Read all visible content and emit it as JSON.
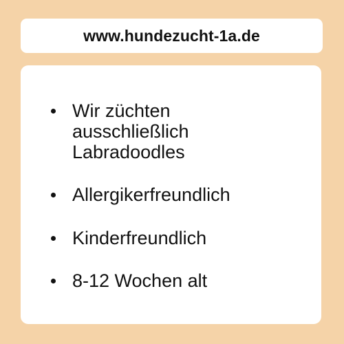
{
  "header": {
    "url": "www.hundezucht-1a.de"
  },
  "features": [
    {
      "label": "Wir züchten\nausschließlich\nLabradoodles"
    },
    {
      "label": "Allergikerfreundlich"
    },
    {
      "label": "Kinderfreundlich"
    },
    {
      "label": "8-12 Wochen alt"
    }
  ],
  "colors": {
    "background": "#f5d3a8",
    "card": "#ffffff",
    "text": "#111111"
  }
}
